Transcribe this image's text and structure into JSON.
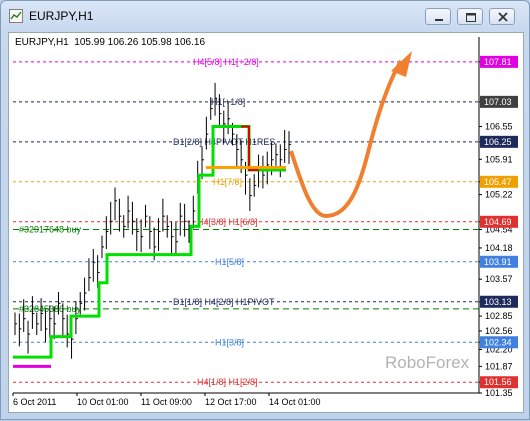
{
  "window": {
    "title": "EURJPY,H1",
    "controls": [
      "minimize",
      "maximize",
      "close"
    ]
  },
  "chart_header": {
    "symbol": "EURJPY,H1",
    "open": "105.99",
    "high": "106.26",
    "low": "105.98",
    "close": "106.16"
  },
  "watermark": "RoboForex",
  "colors": {
    "price_bar": "#000000",
    "green_line": "#00e000",
    "magenta_line": "#e000e0",
    "red_line": "#e00000",
    "orange_line": "#ffa000",
    "forecast_arrow": "#f08030",
    "ask_badge": "#1e2a5a",
    "bid_badge": "#f0a000"
  },
  "chart_data": {
    "type": "line",
    "title": "",
    "ylim": [
      101.35,
      108.1
    ],
    "y_ticks": [
      "107.81",
      "107.03",
      "106.55",
      "106.25",
      "105.91",
      "105.47",
      "105.22",
      "104.69",
      "104.54",
      "104.18",
      "103.91",
      "103.57",
      "103.13",
      "102.85",
      "102.56",
      "102.34",
      "102.20",
      "101.87",
      "101.56",
      "101.35"
    ],
    "x_ticks": [
      "6 Oct 2011",
      "10 Oct 01:00",
      "11 Oct 09:00",
      "12 Oct 17:00",
      "14 Oct 01:00"
    ],
    "levels": [
      {
        "label": "H4[5/8] H1[+2/8]",
        "value": 107.81,
        "color": "#e000e0",
        "badge_color": "#e000e0",
        "badge": "107.81"
      },
      {
        "label": "H1[+1/8]",
        "value": 107.03,
        "color": "#1e2a5a",
        "badge_color": "#404040",
        "badge": "107.03"
      },
      {
        "label": "D1[2/8] H4PIVOT H1RES",
        "value": 106.25,
        "color": "#1e2a5a",
        "badge_color": "#1e2a5a",
        "badge": "106.25"
      },
      {
        "label": "H1[7/8]",
        "value": 105.47,
        "color": "#f0a000",
        "badge_color": "#f0a000",
        "badge": "105.47"
      },
      {
        "label": "H4[3/8] H1[6/8]",
        "value": 104.69,
        "color": "#e03030",
        "badge_color": "#e03030",
        "badge": "104.69"
      },
      {
        "label": "#32917648 buy",
        "value": 104.54,
        "color": "#008000",
        "badge_color": "",
        "badge": ""
      },
      {
        "label": "H1[5/8]",
        "value": 103.91,
        "color": "#4080e0",
        "badge_color": "#4080e0",
        "badge": "103.91"
      },
      {
        "label": "D1[1/8] H4[2/8] H1PIVOT",
        "value": 103.13,
        "color": "#1e2a5a",
        "badge_color": "#1e2a5a",
        "badge": "103.13"
      },
      {
        "label": "#32845386 buy",
        "value": 102.99,
        "color": "#008000",
        "badge_color": "",
        "badge": ""
      },
      {
        "label": "H1[3/8]",
        "value": 102.34,
        "color": "#4080e0",
        "badge_color": "#4080e0",
        "badge": "102.34"
      },
      {
        "label": "H4[1/8] H1[2/8]",
        "value": 101.56,
        "color": "#e03030",
        "badge_color": "#e03030",
        "badge": "101.56"
      }
    ],
    "series": [
      {
        "values": [
          102.7,
          102.6,
          102.8,
          102.5,
          102.9,
          102.7,
          102.9,
          102.6,
          102.8,
          102.7,
          103.1,
          102.8,
          102.5,
          102.4,
          102.8,
          103.1,
          103.3,
          103.6,
          103.9,
          103.7,
          104.2,
          104.5,
          104.7,
          105.1,
          104.8,
          104.6,
          104.9,
          104.7,
          104.5,
          104.4,
          104.8,
          104.5,
          104.2,
          104.5,
          104.8,
          104.6,
          104.4,
          104.3,
          104.8,
          104.7,
          104.5,
          104.9,
          105.5,
          105.9,
          106.4,
          106.9,
          107.1,
          106.8,
          106.6,
          106.7,
          106.4,
          106.1,
          105.9,
          105.6,
          105.2,
          105.4,
          105.7,
          105.6,
          105.8,
          105.9,
          106.0,
          105.9,
          106.1,
          106.2
        ]
      }
    ]
  }
}
